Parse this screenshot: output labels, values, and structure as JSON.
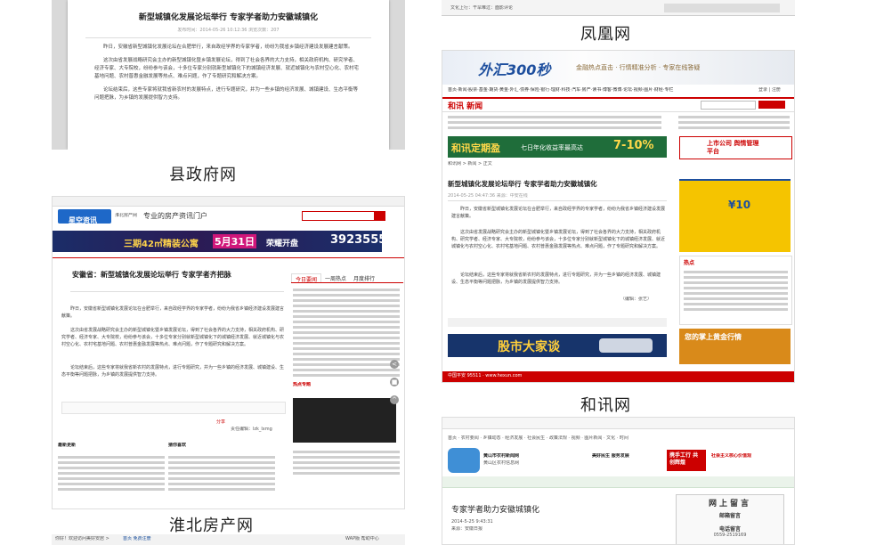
{
  "captions": {
    "county": "县政府网",
    "phoenix": "凤凰网",
    "huaibei": "淮北房产网",
    "hexun": "和讯网"
  },
  "article": {
    "title": "新型城镇化发展论坛举行  专家学者助力安徽城镇化",
    "title_huaibei": "安徽省：新型城镇化发展论坛举行 专家学者齐把脉",
    "title_short": "专家学者助力安徽城镇化",
    "meta_county": "发布时间：2014-05-26 10:12:36  浏览次数：207",
    "meta_hexun": "2014-05-25 04:47:36  来源：中安在线",
    "meta_short": "2014-5-25 9:43:31",
    "p1": "昨日，安徽省新型城镇化发展论坛在合肥举行，来自政经学界的专家学者，纷纷为我省乡镇经济建设发展建言献策。",
    "p2": "这次由省发展战略研究会主办的新型城镇化暨乡镇发展论坛，得到了社会各界的大力支持，相关政府机构、研究学者、经济专家、大专院校，纷纷参与该会，十多位专家分别就新型城镇化下的城镇经济发展、就近城镇化与农村空心化、农村宅基地问题、农村普惠金融发展等热点、难点问题，作了专题研究和解决方案。",
    "p3": "论坛结束后，这些专家将就我省新农村的发展特点，进行专题研究，并为一些乡镇的经济发展、城镇建设、生态平衡等问题把脉，为乡镇的发展提供智力支持。"
  },
  "phoenix": {
    "toplink": "文化上行：干旱难过：面影评论",
    "logo": "凤凰网"
  },
  "hexun": {
    "banner_brand": "外汇300秒",
    "banner_slogan": "金融热点直击 · 行情精准分析 · 专家在线答疑",
    "logo": "和讯 新闻",
    "login": "登录 | 注册",
    "nav": "首页·新闻·股票·基金·期货·黄金·外汇·债券·保险·银行·理财·科技·汽车·房产·读书·博客·微博·论坛·视频·图片·财经·专栏",
    "promo_title": "和讯定期盈",
    "promo_sub": "七日年化收益率最高达",
    "promo_rate": "7-10%",
    "breadcrumb": "和讯网 > 新闻 > 正文",
    "ad_right_top": "上市公司 舆情管理平台",
    "ad_right_mid": "¥10",
    "ad_hot": "热点",
    "ad_gold": "您的掌上黄金行情",
    "ad_stock": "股市大家谈",
    "edit": "（编辑：张艺）",
    "footer_url": "中国平安 95511 · www.hexun.com"
  },
  "huaibei": {
    "brand": "星空资讯",
    "brand_sub": "淮北房产网",
    "slogan": "专业的房产资讯门户",
    "banner_main": "三期42㎡精装公寓",
    "banner_date": "5月31日",
    "banner_open": "荣耀开盘",
    "banner_tel": "3923555",
    "tabs": [
      "今日要闻",
      "一周热点",
      "月度排行"
    ],
    "section1": "最新更新",
    "section2": "猜你喜欢",
    "hot": "热点专题",
    "share": "分享",
    "author": "责任编辑：lzk_lxmg"
  },
  "county_bottom": {
    "site": "黄山市农村新闻网",
    "site2": "黄山区农村信息网",
    "nav": "首页 · 农村要闻 · 乡镇动态 · 经济发展 · 社会民生 · 政策法规 · 视频 · 图片新闻 · 文化 · 时间",
    "banner1": "美好民生 服务发展",
    "banner2": "携手工行 共创辉煌",
    "banner3": "社会主义核心价值观",
    "msg_title": "网上留言",
    "mail": "邮箱留言",
    "phone": "电话留言",
    "phone_no": "0559-2519169",
    "source": "来源：安徽日报"
  },
  "footer": {
    "login_hint": "你好！欢迎访问美好安居 >",
    "links": "首页  免费注册",
    "links_right": "WAP版   帮助中心"
  },
  "colors": {
    "red": "#c00000",
    "blue": "#1a4f9c",
    "orange": "#f08a00",
    "green": "#2e8b57"
  }
}
